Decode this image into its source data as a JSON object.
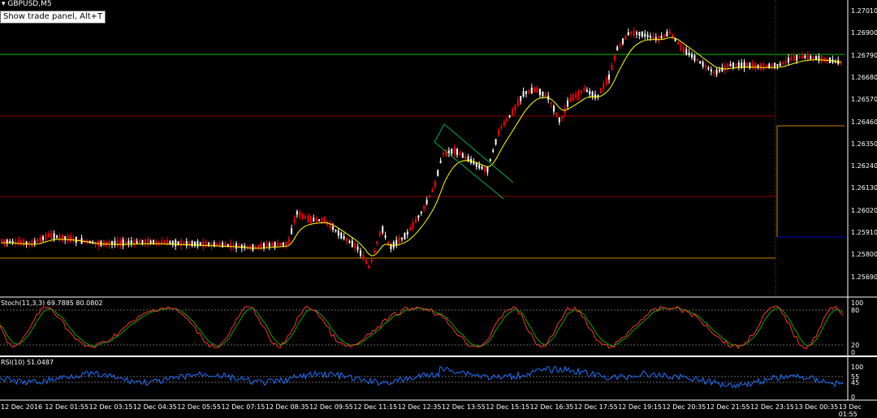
{
  "window": {
    "symbol": "GBPUSD,M5",
    "tooltip": "Show trade panel, Alt+T"
  },
  "price_axis": [
    "1.27010",
    "1.26900",
    "1.26790",
    "1.26680",
    "1.26570",
    "1.26460",
    "1.26350",
    "1.26240",
    "1.26130",
    "1.26020",
    "1.25910",
    "1.25800",
    "1.25690"
  ],
  "time_axis": [
    "12 Dec 2016",
    "12 Dec 01:55",
    "12 Dec 03:15",
    "12 Dec 04:35",
    "12 Dec 05:55",
    "12 Dec 07:15",
    "12 Dec 08:35",
    "12 Dec 09:55",
    "12 Dec 11:15",
    "12 Dec 12:35",
    "12 Dec 13:55",
    "12 Dec 15:15",
    "12 Dec 16:35",
    "12 Dec 17:55",
    "12 Dec 19:15",
    "12 Dec 20:35",
    "12 Dec 21:55",
    "12 Dec 23:15",
    "13 Dec 00:35",
    "13 Dec 01:55"
  ],
  "stoch": {
    "label": "Stoch(11,3,3) 69.7885 80.0802",
    "levels": [
      "100",
      "80",
      "20",
      "0"
    ]
  },
  "rsi": {
    "label": "RSI(10) 51.0487",
    "levels": [
      "100",
      "55",
      "45",
      "0"
    ]
  },
  "colors": {
    "background": "#000000",
    "bull_candle": "#ffffff",
    "bear_candle": "#ff0000",
    "ma_line": "#ffff00",
    "stoch_main": "#ff3030",
    "stoch_signal": "#00aa00",
    "rsi_line": "#1e6fff",
    "green_level": "#00c000",
    "red_level": "#8b0000",
    "orange_level": "#d08000",
    "channel": "#00b050"
  }
}
